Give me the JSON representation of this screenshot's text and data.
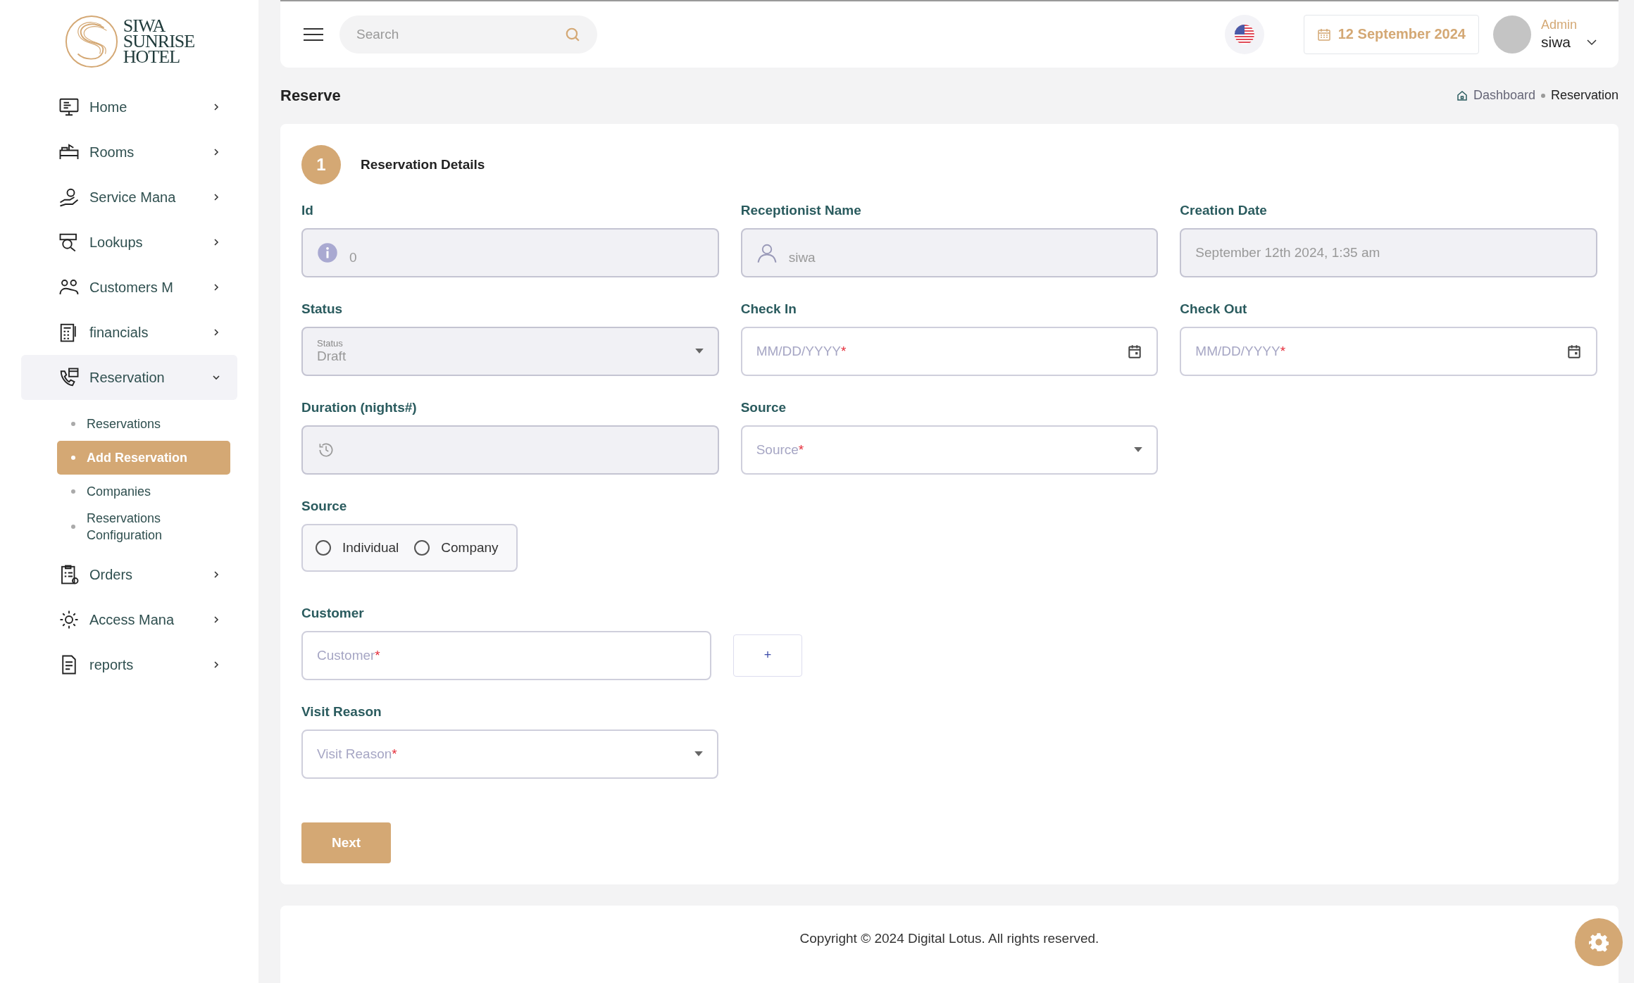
{
  "logo": {
    "lines": [
      "SIWA",
      "SUNRISE",
      "HOTEL"
    ]
  },
  "sidebar": {
    "items": [
      {
        "label": "Home",
        "expanded": false
      },
      {
        "label": "Rooms",
        "expanded": false
      },
      {
        "label": "Service Mana",
        "expanded": false
      },
      {
        "label": "Lookups",
        "expanded": false
      },
      {
        "label": "Customers M",
        "expanded": false
      },
      {
        "label": "financials",
        "expanded": false
      },
      {
        "label": "Reservation",
        "expanded": true,
        "children": [
          {
            "label": "Reservations",
            "selected": false
          },
          {
            "label": "Add Reservation",
            "selected": true
          },
          {
            "label": "Companies",
            "selected": false
          },
          {
            "label": "Reservations Configuration",
            "selected": false
          }
        ]
      },
      {
        "label": "Orders",
        "expanded": false
      },
      {
        "label": "Access Mana",
        "expanded": false
      },
      {
        "label": "reports",
        "expanded": false
      }
    ]
  },
  "header": {
    "search": {
      "placeholder": "Search"
    },
    "date": "12 September 2024",
    "user": {
      "role": "Admin",
      "name": "siwa"
    }
  },
  "page": {
    "title": "Reserve",
    "breadcrumb": [
      {
        "label": "Dashboard",
        "current": false
      },
      {
        "label": "Reservation",
        "current": true
      }
    ]
  },
  "form": {
    "step": {
      "number": "1",
      "title": "Reservation Details"
    },
    "fields": [
      {
        "kind": "text",
        "label": "Id",
        "value": "0",
        "disabled": true
      },
      {
        "kind": "text",
        "label": "Receptionist Name",
        "value": "siwa",
        "disabled": true
      },
      {
        "kind": "text",
        "label": "Creation Date",
        "value": "September 12th 2024, 1:35 am",
        "disabled": true
      },
      {
        "kind": "select",
        "label": "Status",
        "floating_label": "Status",
        "value": "Draft",
        "disabled": true
      },
      {
        "kind": "date",
        "label": "Check In",
        "placeholder": "MM/DD/YYYY",
        "required_mark": "*",
        "disabled": false
      },
      {
        "kind": "date",
        "label": "Check Out",
        "placeholder": "MM/DD/YYYY",
        "required_mark": "*",
        "disabled": false
      },
      {
        "kind": "text",
        "label": "Duration (nights#)",
        "disabled": true
      },
      {
        "kind": "select",
        "label": "Source",
        "placeholder": "Source",
        "required_mark": "*",
        "disabled": false
      }
    ],
    "source_type": {
      "label": "Source",
      "options": [
        {
          "label": "Individual",
          "selected": false
        },
        {
          "label": "Company",
          "selected": false
        }
      ]
    },
    "customer": {
      "label": "Customer",
      "placeholder": "Customer",
      "required_mark": "*",
      "add_button": "+"
    },
    "visit_reason": {
      "label": "Visit Reason",
      "placeholder": "Visit Reason",
      "required_mark": "*"
    },
    "next_button": "Next"
  },
  "footer": {
    "copyright": "Copyright © 2024 Digital Lotus. All rights reserved."
  }
}
